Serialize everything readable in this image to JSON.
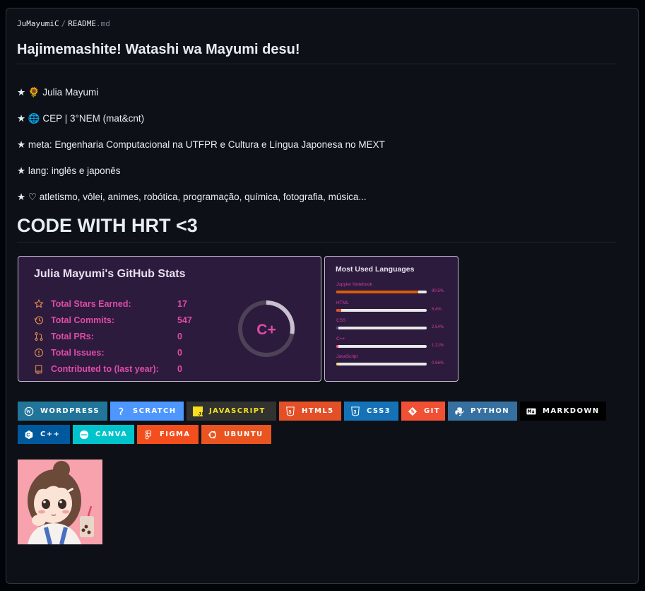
{
  "file": {
    "user": "JuMayumiC",
    "separator": "/",
    "name": "README",
    "ext": ".md"
  },
  "heading": "Hajimemashite! Watashi wa Mayumi desu!",
  "lines": [
    {
      "prefix": "★ ",
      "emoji": "🌻",
      "text": " Julia Mayumi"
    },
    {
      "prefix": "★ ",
      "emoji": "🌐",
      "text": " CEP | 3°NEM (mat&cnt)"
    },
    {
      "prefix": "★ ",
      "emoji": "",
      "text": "meta: Engenharia Computacional na UTFPR e Cultura e Língua Japonesa no MEXT"
    },
    {
      "prefix": "★ ",
      "emoji": "",
      "text": "lang: inglês e japonês"
    },
    {
      "prefix": "★ ",
      "emoji": "♡",
      "text": " atletismo, vôlei, animes, robótica, programação, química, fotografia, música..."
    }
  ],
  "heading2": "CODE WITH HRT <3",
  "stats": {
    "title": "Julia Mayumi's GitHub Stats",
    "rank": "C+",
    "rank_progress": 0.28,
    "rows": [
      {
        "icon": "star-icon",
        "label": "Total Stars Earned:",
        "value": "17"
      },
      {
        "icon": "history-icon",
        "label": "Total Commits:",
        "value": "547"
      },
      {
        "icon": "pull-request-icon",
        "label": "Total PRs:",
        "value": "0"
      },
      {
        "icon": "issue-icon",
        "label": "Total Issues:",
        "value": "0"
      },
      {
        "icon": "repo-icon",
        "label": "Contributed to (last year):",
        "value": "0"
      }
    ]
  },
  "languages": {
    "title": "Most Used Languages",
    "items": [
      {
        "name": "Jupyter Notebook",
        "percent": "90.5%",
        "value": 90.5,
        "color": "#DA5B0B"
      },
      {
        "name": "HTML",
        "percent": "5.4%",
        "value": 5.4,
        "color": "#e34c26"
      },
      {
        "name": "CSS",
        "percent": "2.54%",
        "value": 2.54,
        "color": "#563d7c"
      },
      {
        "name": "C++",
        "percent": "1.21%",
        "value": 1.21,
        "color": "#f34b7d"
      },
      {
        "name": "JavaScript",
        "percent": "0.56%",
        "value": 0.56,
        "color": "#f1e05a"
      }
    ]
  },
  "badges": [
    {
      "label": "WORDPRESS",
      "icon": "wordpress-icon",
      "color": "#21759B",
      "text": "#ffffff"
    },
    {
      "label": "SCRATCH",
      "icon": "scratch-icon",
      "color": "#4D97FF",
      "text": "#ffffff"
    },
    {
      "label": "JAVASCRIPT",
      "icon": "javascript-icon",
      "color": "#323330",
      "text": "#F7DF1E"
    },
    {
      "label": "HTML5",
      "icon": "html5-icon",
      "color": "#E34F26",
      "text": "#ffffff"
    },
    {
      "label": "CSS3",
      "icon": "css3-icon",
      "color": "#1572B6",
      "text": "#ffffff"
    },
    {
      "label": "GIT",
      "icon": "git-icon",
      "color": "#F05033",
      "text": "#ffffff"
    },
    {
      "label": "PYTHON",
      "icon": "python-icon",
      "color": "#3670A0",
      "text": "#ffffff"
    },
    {
      "label": "MARKDOWN",
      "icon": "markdown-icon",
      "color": "#000000",
      "text": "#ffffff"
    },
    {
      "label": "C++",
      "icon": "cplusplus-icon",
      "color": "#00599C",
      "text": "#ffffff"
    },
    {
      "label": "CANVA",
      "icon": "canva-icon",
      "color": "#00C4CC",
      "text": "#ffffff"
    },
    {
      "label": "FIGMA",
      "icon": "figma-icon",
      "color": "#F24E1E",
      "text": "#ffffff"
    },
    {
      "label": "UBUNTU",
      "icon": "ubuntu-icon",
      "color": "#E95420",
      "text": "#ffffff"
    }
  ]
}
